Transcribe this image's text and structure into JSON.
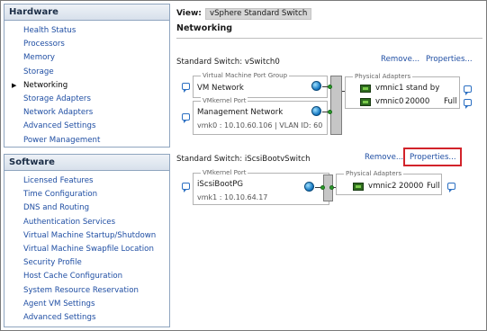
{
  "hardware": {
    "title": "Hardware",
    "items": [
      {
        "label": "Health Status"
      },
      {
        "label": "Processors"
      },
      {
        "label": "Memory"
      },
      {
        "label": "Storage"
      },
      {
        "label": "Networking"
      },
      {
        "label": "Storage Adapters"
      },
      {
        "label": "Network Adapters"
      },
      {
        "label": "Advanced Settings"
      },
      {
        "label": "Power Management"
      }
    ],
    "active_index": 4
  },
  "software": {
    "title": "Software",
    "items": [
      {
        "label": "Licensed Features"
      },
      {
        "label": "Time Configuration"
      },
      {
        "label": "DNS and Routing"
      },
      {
        "label": "Authentication Services"
      },
      {
        "label": "Virtual Machine Startup/Shutdown"
      },
      {
        "label": "Virtual Machine Swapfile Location"
      },
      {
        "label": "Security Profile"
      },
      {
        "label": "Host Cache Configuration"
      },
      {
        "label": "System Resource Reservation"
      },
      {
        "label": "Agent VM Settings"
      },
      {
        "label": "Advanced Settings"
      }
    ]
  },
  "view": {
    "label": "View:",
    "value": "vSphere Standard Switch"
  },
  "page_title": "Networking",
  "switch0": {
    "title": "Standard Switch: vSwitch0",
    "remove": "Remove...",
    "properties": "Properties...",
    "vm_port_group": {
      "caption": "Virtual Machine Port Group",
      "name": "VM Network"
    },
    "vmkernel_port": {
      "caption": "VMkernel Port",
      "name": "Management Network",
      "detail": "vmk0 : 10.10.60.106 | VLAN ID: 60"
    },
    "physical_adapters": {
      "caption": "Physical Adapters",
      "adapters": [
        {
          "name": "vmnic1",
          "speed": "stand by",
          "duplex": ""
        },
        {
          "name": "vmnic0",
          "speed": "20000",
          "duplex": "Full"
        }
      ]
    }
  },
  "switch1": {
    "title": "Standard Switch: iScsiBootvSwitch",
    "remove": "Remove...",
    "properties": "Properties...",
    "vmkernel_port": {
      "caption": "VMkernel Port",
      "name": "iScsiBootPG",
      "detail": "vmk1 : 10.10.64.17"
    },
    "physical_adapters": {
      "caption": "Physical Adapters",
      "adapters": [
        {
          "name": "vmnic2",
          "speed": "20000",
          "duplex": "Full"
        }
      ]
    }
  },
  "colors": {
    "link": "#1f4ea3",
    "highlight": "#d2232a",
    "nic_green": "#2e6b1f"
  }
}
